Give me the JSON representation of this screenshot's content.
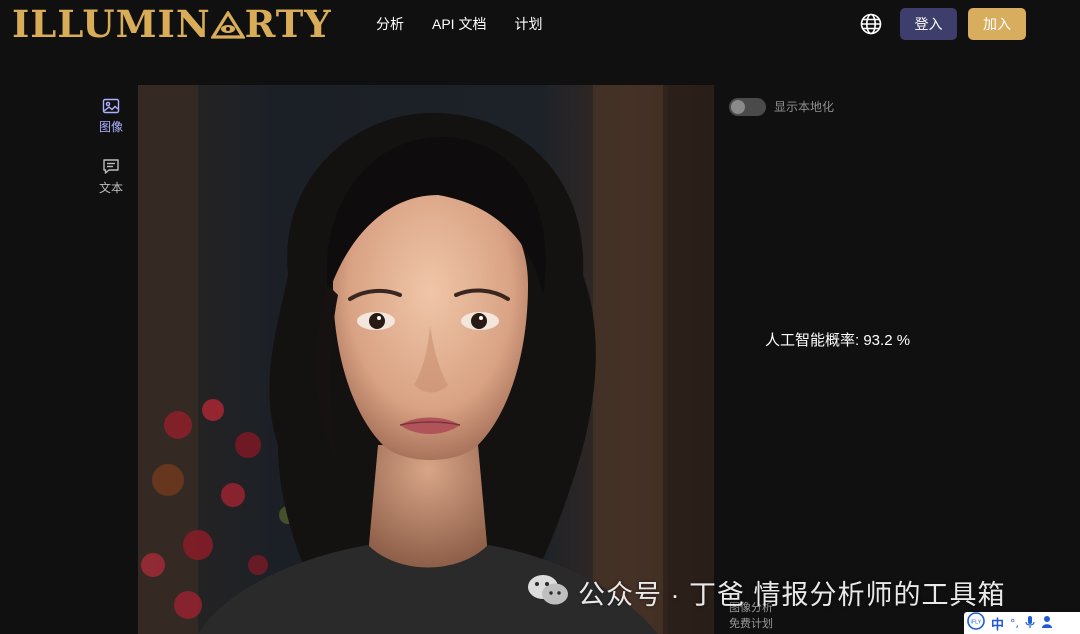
{
  "header": {
    "logo": "ILLUMINARTY",
    "logo_before_eye": "ILLUMIN",
    "logo_after_eye": "RTY",
    "nav": [
      {
        "label": "分析"
      },
      {
        "label": "API 文档"
      },
      {
        "label": "计划"
      }
    ],
    "login_label": "登入",
    "join_label": "加入",
    "accent_gold": "#d9ad5e",
    "accent_indigo": "#3d3e6c"
  },
  "tools": [
    {
      "label": "图像",
      "icon": "image-icon"
    },
    {
      "label": "文本",
      "icon": "message-icon"
    }
  ],
  "panel": {
    "toggle_label": "显示本地化",
    "probability_text": "人工智能概率: 93.2 %",
    "probability_value": 93.2
  },
  "footer": {
    "link_1": "图像分析",
    "link_2": "免费计划"
  },
  "watermark": {
    "text": "公众号 · 丁爸 情报分析师的工具箱"
  },
  "ime": {
    "lang": "中",
    "brand": "iFLY"
  }
}
